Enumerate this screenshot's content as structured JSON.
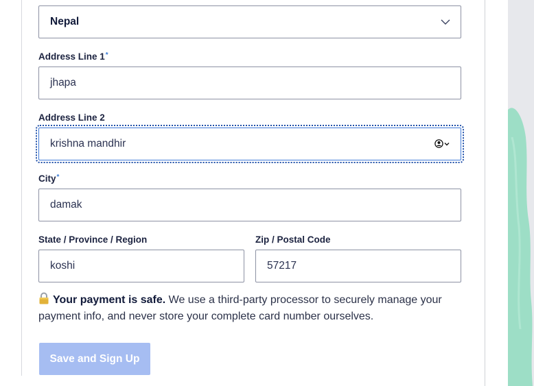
{
  "country": {
    "value": "Nepal"
  },
  "address1": {
    "label": "Address Line 1",
    "required_mark": "*",
    "value": "jhapa"
  },
  "address2": {
    "label": "Address Line 2",
    "value": "krishna mandhir"
  },
  "city": {
    "label": "City",
    "required_mark": "*",
    "value": "damak"
  },
  "state": {
    "label": "State / Province / Region",
    "value": "koshi"
  },
  "zip": {
    "label": "Zip / Postal Code",
    "value": "57217"
  },
  "notice": {
    "bold": "Your payment is safe.",
    "text": " We use a third-party processor to securely manage your payment info, and never store your complete card number ourselves."
  },
  "submit": {
    "label": "Save and Sign Up"
  },
  "colors": {
    "button": "#a6bdf2",
    "focus": "#3c78d8",
    "required": "#3a7bd5",
    "decor_green": "#8fdcc0"
  },
  "icons": {
    "select": "chevron-down-icon",
    "autofill": "contact-autofill-icon",
    "notice": "lock-icon"
  }
}
